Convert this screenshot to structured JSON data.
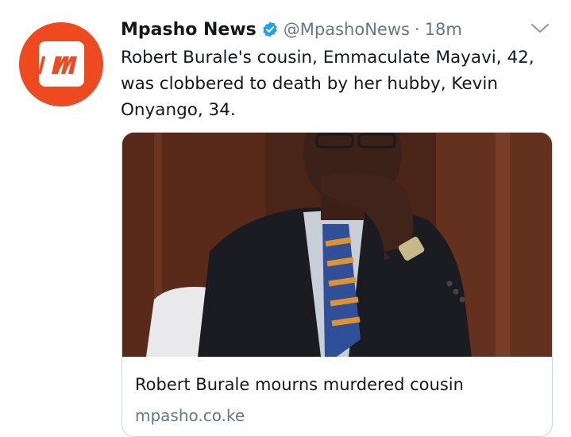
{
  "tweet": {
    "display_name": "Mpasho News",
    "handle": "@MpashoNews",
    "separator": "·",
    "time": "18m",
    "verified": true,
    "text": "Robert Burale's cousin, Emmaculate Mayavi, 42, was clobbered to death by her hubby, Kevin Onyango, 34.",
    "avatar": {
      "glyph": "m",
      "brand_color": "#ef4a1f"
    }
  },
  "card": {
    "title": "Robert Burale mourns murdered cousin",
    "domain": "mpasho.co.ke"
  },
  "colors": {
    "primary_text": "#14171a",
    "secondary_text": "#657786",
    "verified_blue": "#1da1f2",
    "card_border": "#ccd6dd"
  },
  "icons": {
    "verified": "verified-badge-icon",
    "caret": "chevron-down-icon"
  }
}
